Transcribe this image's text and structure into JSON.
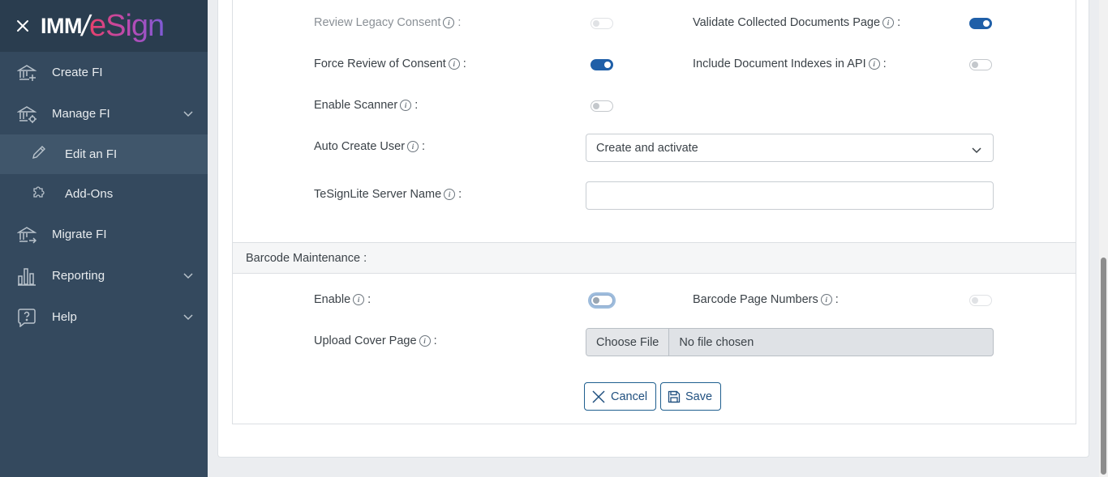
{
  "brand": {
    "imm": "IMM",
    "esign": "eSign"
  },
  "sidebar": {
    "items": [
      {
        "label": "Create FI"
      },
      {
        "label": "Manage FI"
      },
      {
        "label": "Edit an FI"
      },
      {
        "label": "Add-Ons"
      },
      {
        "label": "Migrate FI"
      },
      {
        "label": "Reporting"
      },
      {
        "label": "Help"
      }
    ]
  },
  "settings": {
    "review_legacy_consent": {
      "label": "Review Legacy Consent",
      "enabled": false,
      "disabled": true
    },
    "validate_collected_docs": {
      "label": "Validate Collected Documents Page",
      "enabled": true
    },
    "force_review_consent": {
      "label": "Force Review of Consent",
      "enabled": true
    },
    "include_doc_indexes": {
      "label": "Include Document Indexes in API",
      "enabled": false
    },
    "enable_scanner": {
      "label": "Enable Scanner",
      "enabled": false
    },
    "auto_create_user": {
      "label": "Auto Create User",
      "value": "Create and activate"
    },
    "tesignlite_server": {
      "label": "TeSignLite Server Name",
      "value": ""
    }
  },
  "barcode": {
    "section_title": "Barcode Maintenance :",
    "enable": {
      "label": "Enable",
      "enabled": false
    },
    "page_numbers": {
      "label": "Barcode Page Numbers",
      "enabled": false,
      "disabled": true
    },
    "upload_cover": {
      "label": "Upload Cover Page",
      "button": "Choose File",
      "status": "No file chosen"
    }
  },
  "actions": {
    "cancel": "Cancel",
    "save": "Save"
  },
  "info_glyph": "i",
  "colon": ":",
  "colors": {
    "sidebar": "#34495e",
    "sidebar_header": "#2a3d4f",
    "toggle_on": "#1f5fa8",
    "primary_border": "#1f5f8f"
  }
}
